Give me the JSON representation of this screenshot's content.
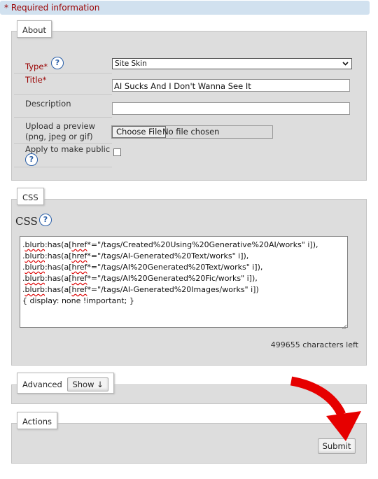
{
  "notice": {
    "text": "* Required information"
  },
  "about": {
    "legend": "About",
    "type_label": "Type*",
    "type_value": "Site Skin",
    "title_label": "Title*",
    "title_value": "AI Sucks And I Don't Wanna See It",
    "description_label": "Description",
    "description_value": "",
    "preview_label_line1": "Upload a preview",
    "preview_label_line2": "(png, jpeg or gif)",
    "file_button": "Choose File",
    "file_status": "No file chosen",
    "public_label": "Apply to make public",
    "public_checked": false,
    "help_glyph": "?"
  },
  "css": {
    "legend": "CSS",
    "heading": "CSS",
    "help_glyph": "?",
    "lines": [
      {
        "sel": ".blurb:has(a[href",
        "rest": "*=\"/tags/Created%20Using%20Generative%20AI/works\" i]),"
      },
      {
        "sel": ".blurb:has(a[href",
        "rest": "*=\"/tags/AI-Generated%20Text/works\" i]),"
      },
      {
        "sel": ".blurb:has(a[href",
        "rest": "*=\"/tags/AI%20Generated%20Text/works\" i]),"
      },
      {
        "sel": ".blurb:has(a[href",
        "rest": "*=\"/tags/AI%20Generated%20Fic/works\" i]),"
      },
      {
        "sel": ".blurb:has(a[href",
        "rest": "*=\"/tags/AI-Generated%20Images/works\" i])"
      }
    ],
    "last_line": "{ display: none !important; }",
    "chars_left": "499655 characters left"
  },
  "advanced": {
    "legend": "Advanced",
    "show_button": "Show ↓"
  },
  "actions": {
    "legend": "Actions",
    "submit_button": "Submit"
  },
  "colors": {
    "required": "#990000",
    "notice_bg": "#d1e1ef",
    "panel_bg": "#dddddd",
    "help": "#2a5fa8",
    "arrow": "#e60000"
  },
  "icons": {
    "help": "help-circle-icon",
    "dropdown": "chevron-down-icon",
    "annotation": "red-curved-arrow"
  }
}
